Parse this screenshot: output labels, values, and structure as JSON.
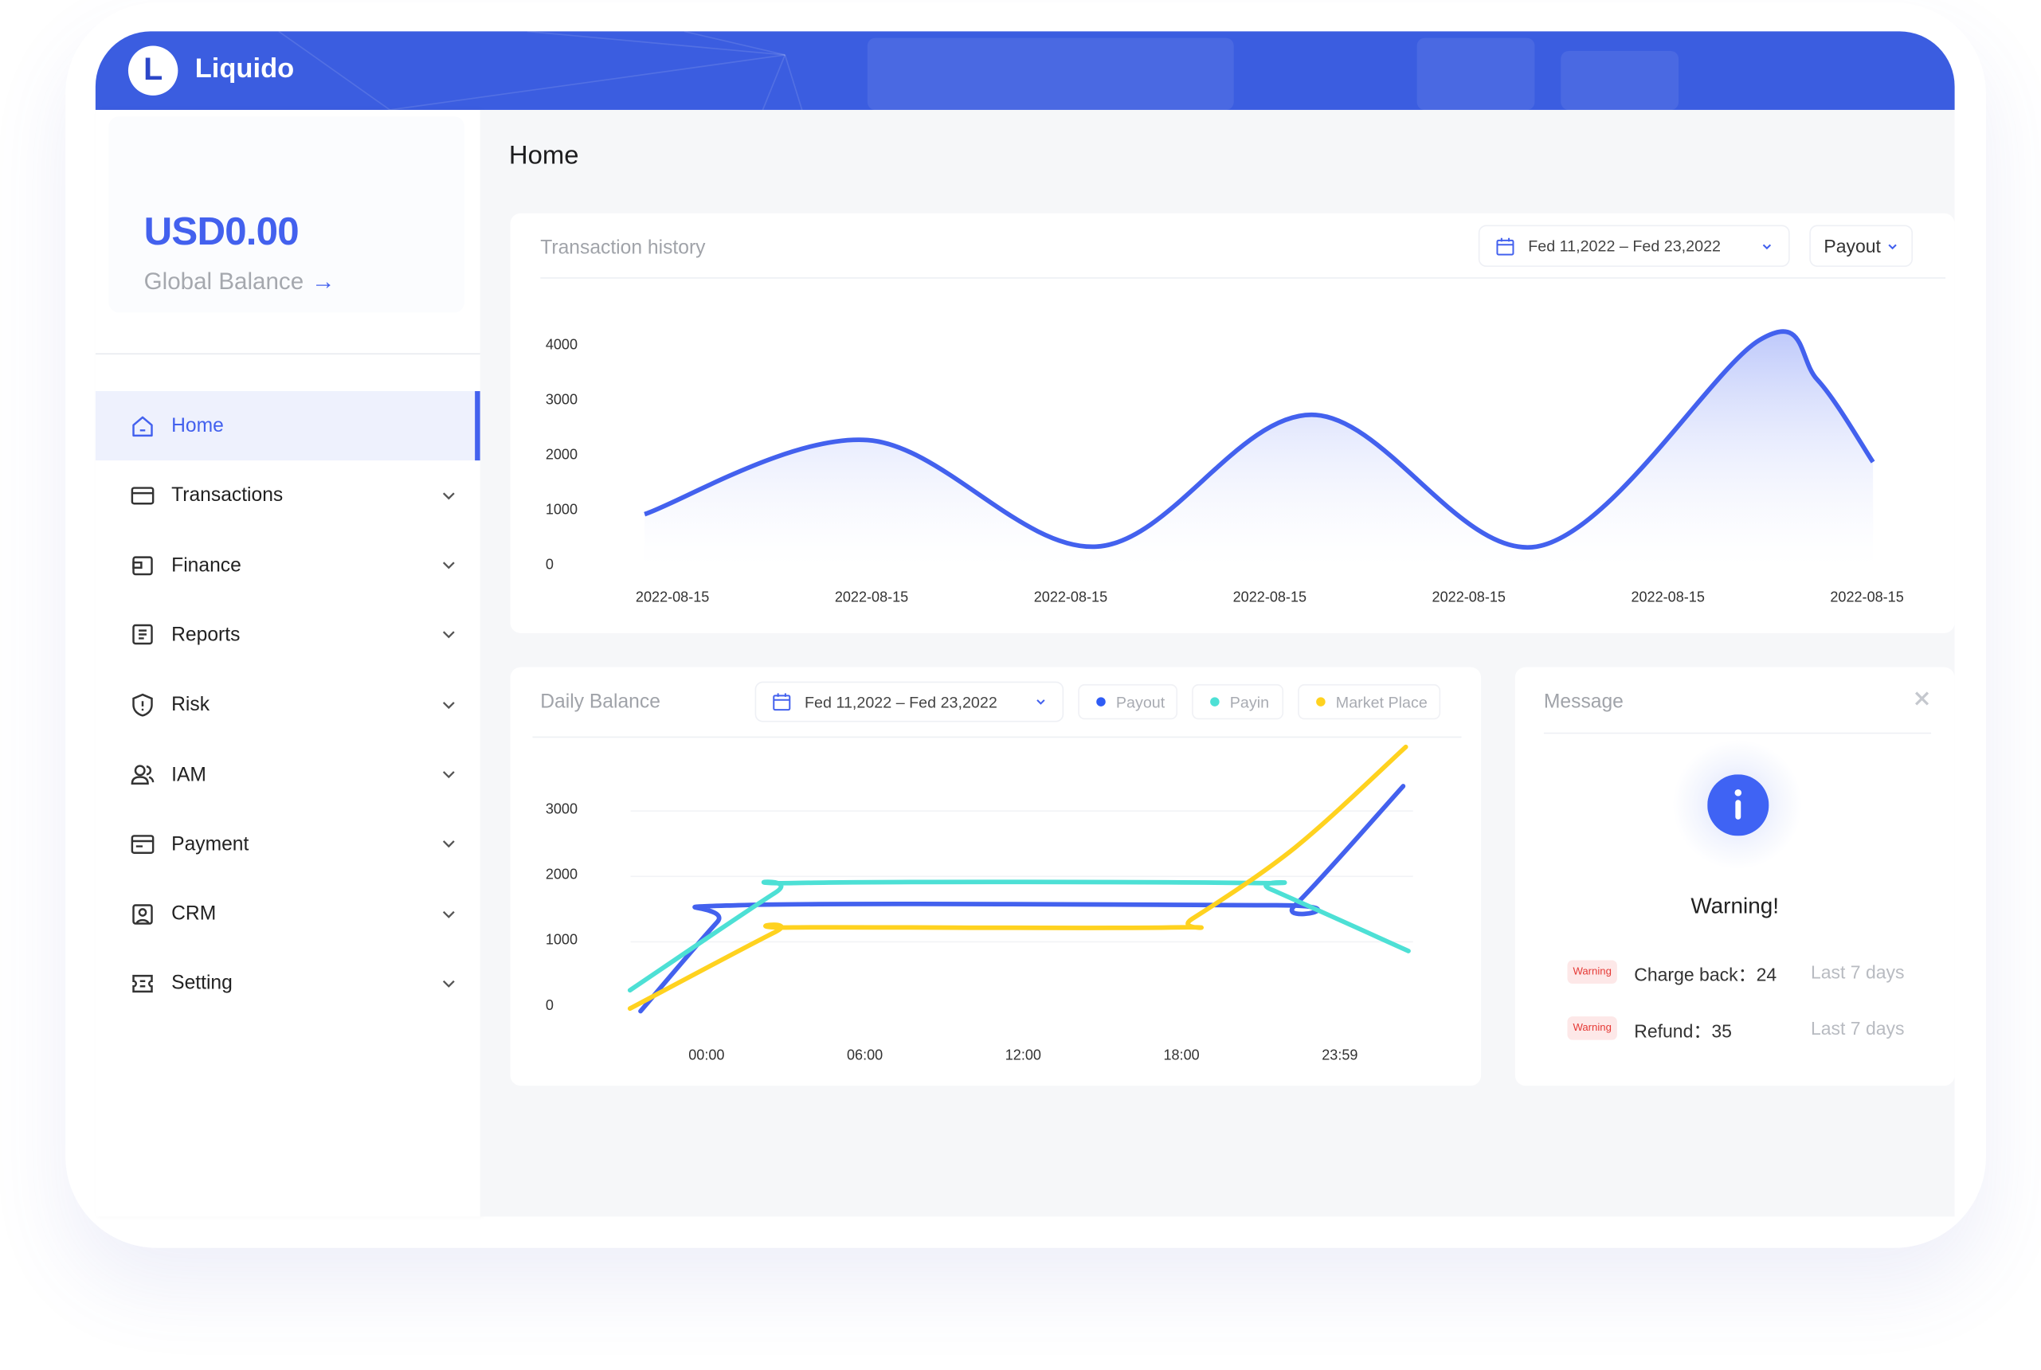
{
  "app": {
    "logo_letter": "L",
    "name": "Liquido"
  },
  "balance": {
    "amount": "USD0.00",
    "label": "Global Balance",
    "arrow": "→"
  },
  "sidebar": {
    "items": [
      {
        "label": "Home",
        "icon": "home-icon",
        "active": true
      },
      {
        "label": "Transactions",
        "icon": "card-icon"
      },
      {
        "label": "Finance",
        "icon": "wallet-icon"
      },
      {
        "label": "Reports",
        "icon": "report-icon"
      },
      {
        "label": "Risk",
        "icon": "shield-icon"
      },
      {
        "label": "IAM",
        "icon": "users-icon"
      },
      {
        "label": "Payment",
        "icon": "payment-icon"
      },
      {
        "label": "CRM",
        "icon": "contact-icon"
      },
      {
        "label": "Setting",
        "icon": "setting-icon"
      }
    ]
  },
  "page": {
    "title": "Home"
  },
  "transaction_history": {
    "title": "Transaction history",
    "date_range": "Fed 11,2022 – Fed 23,2022",
    "type_select": "Payout"
  },
  "daily_balance": {
    "title": "Daily Balance",
    "date_range": "Fed 11,2022 – Fed 23,2022",
    "legend": [
      {
        "label": "Payout",
        "color": "#2f5cf5"
      },
      {
        "label": "Payin",
        "color": "#4de0d5"
      },
      {
        "label": "Market Place",
        "color": "#ffd21f"
      }
    ]
  },
  "message": {
    "title": "Message",
    "heading": "Warning!",
    "rows": [
      {
        "badge": "Warning",
        "text": "Charge back：24",
        "period": "Last 7 days"
      },
      {
        "badge": "Warning",
        "text": "Refund：35",
        "period": "Last 7 days"
      }
    ]
  },
  "colors": {
    "brand": "#3b5de0",
    "accent": "#4361ee"
  },
  "chart_data": [
    {
      "type": "area",
      "title": "Transaction history",
      "categories": [
        "2022-08-15",
        "2022-08-15",
        "2022-08-15",
        "2022-08-15",
        "2022-08-15",
        "2022-08-15",
        "2022-08-15"
      ],
      "yticks": [
        0,
        1000,
        2000,
        3000,
        4000
      ],
      "ylim": [
        0,
        4000
      ],
      "grid": false,
      "series": [
        {
          "color": "#4361ee",
          "points": [
            [
              -0.14,
              950
            ],
            [
              0.98,
              2300
            ],
            [
              2.13,
              360
            ],
            [
              3.21,
              2760
            ],
            [
              4.34,
              360
            ],
            [
              5.46,
              4120
            ],
            [
              5.75,
              3400
            ],
            [
              6.03,
              1900
            ]
          ]
        }
      ]
    },
    {
      "type": "line",
      "title": "Daily Balance",
      "xticks": [
        "00:00",
        "06:00",
        "12:00",
        "18:00",
        "23:59"
      ],
      "yticks": [
        0,
        1000,
        2000,
        3000
      ],
      "grid": true,
      "legend": "top",
      "series": [
        {
          "name": "Payout",
          "color": "#4361ee",
          "points": [
            [
              -2.5,
              -60
            ],
            [
              0.4,
              1300
            ],
            [
              1.2,
              1560
            ],
            [
              21.6,
              1560
            ],
            [
              22.3,
              1560
            ],
            [
              26.4,
              3380
            ]
          ]
        },
        {
          "name": "Payin",
          "color": "#4de0d5",
          "points": [
            [
              -2.9,
              260
            ],
            [
              2.6,
              1750
            ],
            [
              3.5,
              1900
            ],
            [
              20.6,
              1900
            ],
            [
              21.4,
              1800
            ],
            [
              26.6,
              860
            ]
          ]
        },
        {
          "name": "Market Place",
          "color": "#ffd21f",
          "points": [
            [
              -2.9,
              -20
            ],
            [
              2.6,
              1150
            ],
            [
              3.3,
              1220
            ],
            [
              17.6,
              1220
            ],
            [
              18.4,
              1350
            ],
            [
              22.3,
              2440
            ],
            [
              26.5,
              3980
            ]
          ]
        }
      ]
    }
  ]
}
